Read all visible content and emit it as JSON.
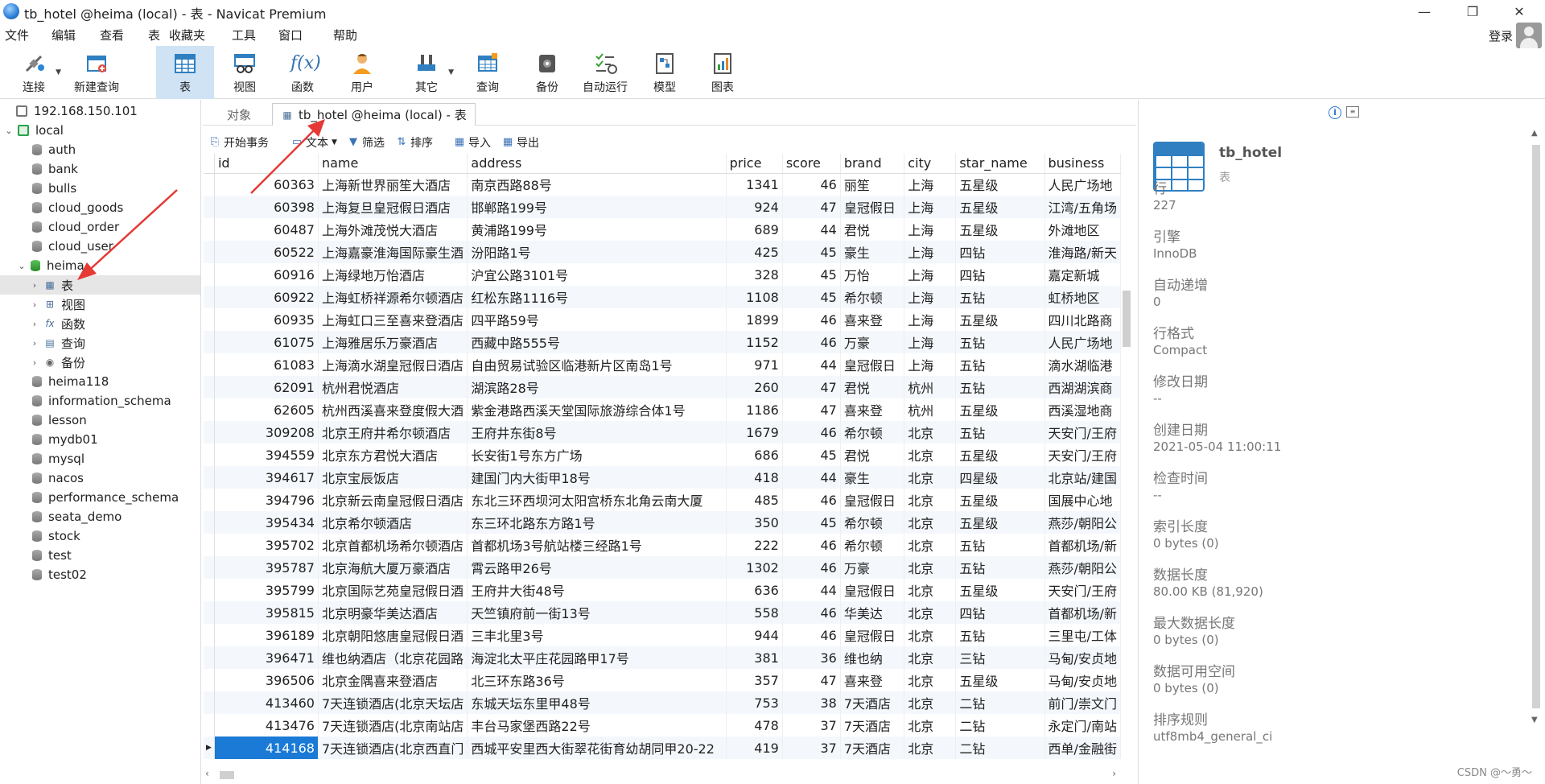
{
  "window": {
    "title": "tb_hotel @heima (local) - 表 - Navicat Premium",
    "minimize": "—",
    "restore": "❐",
    "close": "✕"
  },
  "menu": [
    "文件",
    "编辑",
    "查看",
    "表",
    "收藏夹",
    "工具",
    "窗口",
    "帮助"
  ],
  "login_label": "登录",
  "toolbar": {
    "connect": "连接",
    "new_query": "新建查询",
    "table": "表",
    "view": "视图",
    "function": "函数",
    "user": "用户",
    "other": "其它",
    "query": "查询",
    "backup": "备份",
    "automation": "自动运行",
    "model": "模型",
    "chart": "图表"
  },
  "sidebar": {
    "connection_remote": "192.168.150.101",
    "connection_local": "local",
    "databases_before": [
      "auth",
      "bank",
      "bulls",
      "cloud_goods",
      "cloud_order",
      "cloud_user"
    ],
    "heima": "heima",
    "heima_children": [
      "表",
      "视图",
      "函数",
      "查询",
      "备份"
    ],
    "databases_after": [
      "heima118",
      "information_schema",
      "lesson",
      "mydb01",
      "mysql",
      "nacos",
      "performance_schema",
      "seata_demo",
      "stock",
      "test",
      "test02"
    ]
  },
  "tabs": {
    "objects": "对象",
    "active": "tb_hotel @heima (local) - 表"
  },
  "gridbar": {
    "begin_transaction": "开始事务",
    "text": "文本",
    "filter": "筛选",
    "sort": "排序",
    "import": "导入",
    "export": "导出"
  },
  "grid": {
    "columns": [
      "id",
      "name",
      "address",
      "price",
      "score",
      "brand",
      "city",
      "star_name",
      "business"
    ],
    "rows": [
      [
        "60363",
        "上海新世界丽笙大酒店",
        "南京西路88号",
        "1341",
        "46",
        "丽笙",
        "上海",
        "五星级",
        "人民广场地"
      ],
      [
        "60398",
        "上海复旦皇冠假日酒店",
        "邯郸路199号",
        "924",
        "47",
        "皇冠假日",
        "上海",
        "五星级",
        "江湾/五角场"
      ],
      [
        "60487",
        "上海外滩茂悦大酒店",
        "黄浦路199号",
        "689",
        "44",
        "君悦",
        "上海",
        "五星级",
        "外滩地区"
      ],
      [
        "60522",
        "上海嘉豪淮海国际豪生酒",
        "汾阳路1号",
        "425",
        "45",
        "豪生",
        "上海",
        "四钻",
        "淮海路/新天"
      ],
      [
        "60916",
        "上海绿地万怡酒店",
        "沪宜公路3101号",
        "328",
        "45",
        "万怡",
        "上海",
        "四钻",
        "嘉定新城"
      ],
      [
        "60922",
        "上海虹桥祥源希尔顿酒店",
        "红松东路1116号",
        "1108",
        "45",
        "希尔顿",
        "上海",
        "五钻",
        "虹桥地区"
      ],
      [
        "60935",
        "上海虹口三至喜来登酒店",
        "四平路59号",
        "1899",
        "46",
        "喜来登",
        "上海",
        "五星级",
        "四川北路商"
      ],
      [
        "61075",
        "上海雅居乐万豪酒店",
        "西藏中路555号",
        "1152",
        "46",
        "万豪",
        "上海",
        "五钻",
        "人民广场地"
      ],
      [
        "61083",
        "上海滴水湖皇冠假日酒店",
        "自由贸易试验区临港新片区南岛1号",
        "971",
        "44",
        "皇冠假日",
        "上海",
        "五钻",
        "滴水湖临港"
      ],
      [
        "62091",
        "杭州君悦酒店",
        "湖滨路28号",
        "260",
        "47",
        "君悦",
        "杭州",
        "五钻",
        "西湖湖滨商"
      ],
      [
        "62605",
        "杭州西溪喜来登度假大酒",
        "紫金港路西溪天堂国际旅游综合体1号",
        "1186",
        "47",
        "喜来登",
        "杭州",
        "五星级",
        "西溪湿地商"
      ],
      [
        "309208",
        "北京王府井希尔顿酒店",
        "王府井东街8号",
        "1679",
        "46",
        "希尔顿",
        "北京",
        "五钻",
        "天安门/王府"
      ],
      [
        "394559",
        "北京东方君悦大酒店",
        "长安街1号东方广场",
        "686",
        "45",
        "君悦",
        "北京",
        "五星级",
        "天安门/王府"
      ],
      [
        "394617",
        "北京宝辰饭店",
        "建国门内大街甲18号",
        "418",
        "44",
        "豪生",
        "北京",
        "四星级",
        "北京站/建国"
      ],
      [
        "394796",
        "北京新云南皇冠假日酒店",
        "东北三环西坝河太阳宫桥东北角云南大厦",
        "485",
        "46",
        "皇冠假日",
        "北京",
        "五星级",
        "国展中心地"
      ],
      [
        "395434",
        "北京希尔顿酒店",
        "东三环北路东方路1号",
        "350",
        "45",
        "希尔顿",
        "北京",
        "五星级",
        "燕莎/朝阳公"
      ],
      [
        "395702",
        "北京首都机场希尔顿酒店",
        "首都机场3号航站楼三经路1号",
        "222",
        "46",
        "希尔顿",
        "北京",
        "五钻",
        "首都机场/新"
      ],
      [
        "395787",
        "北京海航大厦万豪酒店",
        "霄云路甲26号",
        "1302",
        "46",
        "万豪",
        "北京",
        "五钻",
        "燕莎/朝阳公"
      ],
      [
        "395799",
        "北京国际艺苑皇冠假日酒",
        "王府井大街48号",
        "636",
        "44",
        "皇冠假日",
        "北京",
        "五星级",
        "天安门/王府"
      ],
      [
        "395815",
        "北京明豪华美达酒店",
        "天竺镇府前一街13号",
        "558",
        "46",
        "华美达",
        "北京",
        "四钻",
        "首都机场/新"
      ],
      [
        "396189",
        "北京朝阳悠唐皇冠假日酒",
        "三丰北里3号",
        "944",
        "46",
        "皇冠假日",
        "北京",
        "五钻",
        "三里屯/工体"
      ],
      [
        "396471",
        "维也纳酒店（北京花园路",
        "海淀北太平庄花园路甲17号",
        "381",
        "36",
        "维也纳",
        "北京",
        "三钻",
        "马甸/安贞地"
      ],
      [
        "396506",
        "北京金隅喜来登酒店",
        "北三环东路36号",
        "357",
        "47",
        "喜来登",
        "北京",
        "五星级",
        "马甸/安贞地"
      ],
      [
        "413460",
        "7天连锁酒店(北京天坛店",
        "东城天坛东里甲48号",
        "753",
        "38",
        "7天酒店",
        "北京",
        "二钻",
        "前门/崇文门"
      ],
      [
        "413476",
        "7天连锁酒店(北京南站店",
        "丰台马家堡西路22号",
        "478",
        "37",
        "7天酒店",
        "北京",
        "二钻",
        "永定门/南站"
      ],
      [
        "414168",
        "7天连锁酒店(北京西直门",
        "西城平安里西大街翠花街育幼胡同甲20-22",
        "419",
        "37",
        "7天酒店",
        "北京",
        "二钻",
        "西单/金融街"
      ]
    ]
  },
  "info": {
    "table_name": "tb_hotel",
    "table_type": "表",
    "fields": [
      {
        "label": "行",
        "value": "227"
      },
      {
        "label": "引擎",
        "value": "InnoDB"
      },
      {
        "label": "自动递增",
        "value": "0"
      },
      {
        "label": "行格式",
        "value": "Compact"
      },
      {
        "label": "修改日期",
        "value": "--"
      },
      {
        "label": "创建日期",
        "value": "2021-05-04 11:00:11"
      },
      {
        "label": "检查时间",
        "value": "--"
      },
      {
        "label": "索引长度",
        "value": "0 bytes (0)"
      },
      {
        "label": "数据长度",
        "value": "80.00 KB (81,920)"
      },
      {
        "label": "最大数据长度",
        "value": "0 bytes (0)"
      },
      {
        "label": "数据可用空间",
        "value": "0 bytes (0)"
      },
      {
        "label": "排序规则",
        "value": "utf8mb4_general_ci"
      }
    ]
  },
  "watermark": "CSDN @～勇～",
  "colors": {
    "accent": "#1a7ad6",
    "toolbar_active": "#cfe3f5",
    "annotation_arrow": "#e53935"
  }
}
